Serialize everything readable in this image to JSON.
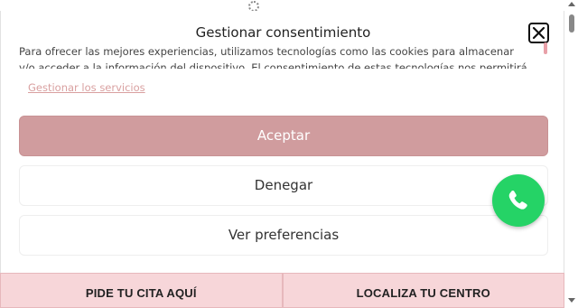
{
  "consent": {
    "title": "Gestionar consentimiento",
    "intro_line1": "Para ofrecer las mejores experiencias, utilizamos tecnologías como las cookies para almacenar",
    "intro_line2": "y/o acceder a la información del dispositivo. El consentimiento de estas tecnologías nos permitirá",
    "services_link": "Gestionar los servicios",
    "accept_label": "Aceptar",
    "deny_label": "Denegar",
    "preferences_label": "Ver preferencias"
  },
  "bottom_bar": {
    "appointment_label": "PIDE TU CITA AQUÍ",
    "locate_label": "LOCALIZA TU CENTRO"
  },
  "colors": {
    "accept_bg": "#d09c9e",
    "bottom_bar_bg": "#f7d6d9",
    "whatsapp_green": "#25d366",
    "link_color": "#d9a0a0"
  },
  "icons": {
    "close": "close-icon",
    "whatsapp": "whatsapp-icon",
    "loading": "spinner-icon"
  }
}
